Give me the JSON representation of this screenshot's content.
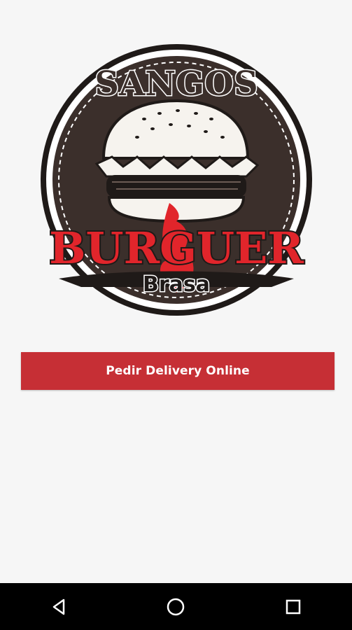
{
  "logo": {
    "top_text": "SANGOS",
    "main_text": "BURGUER",
    "sub_text": "Brasa",
    "colors": {
      "dark": "#3b2f2b",
      "red": "#e1252b",
      "cream": "#f6f3ee"
    }
  },
  "cta": {
    "label": "Pedir Delivery Online",
    "color": "#c62f35"
  },
  "navbar": {
    "back_icon": "triangle-back-icon",
    "home_icon": "circle-home-icon",
    "recents_icon": "square-recents-icon"
  }
}
